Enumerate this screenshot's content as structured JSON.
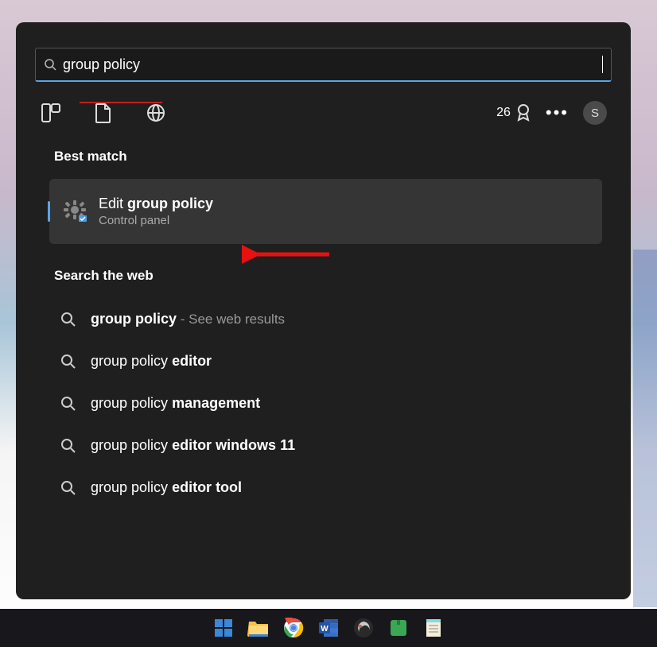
{
  "search": {
    "query": "group policy"
  },
  "rewards": {
    "count": "26"
  },
  "avatar": {
    "initial": "S"
  },
  "sections": {
    "best_match": "Best match",
    "search_web": "Search the web"
  },
  "best_match_result": {
    "title_prefix": "Edit ",
    "title_bold": "group policy",
    "subtitle": "Control panel"
  },
  "web_results": [
    {
      "prefix": "",
      "bold_first": "group policy",
      "middle": "",
      "bold_second": "",
      "suffix": " - See web results"
    },
    {
      "prefix": "group policy ",
      "bold_first": "",
      "middle": "",
      "bold_second": "editor",
      "suffix": ""
    },
    {
      "prefix": "group policy ",
      "bold_first": "",
      "middle": "",
      "bold_second": "management",
      "suffix": ""
    },
    {
      "prefix": "group policy ",
      "bold_first": "",
      "middle": "",
      "bold_second": "editor windows 11",
      "suffix": ""
    },
    {
      "prefix": "group policy ",
      "bold_first": "",
      "middle": "",
      "bold_second": "editor tool",
      "suffix": ""
    }
  ],
  "taskbar": {
    "items": [
      "start",
      "file-explorer",
      "chrome",
      "word",
      "obs",
      "app-green",
      "notepad"
    ]
  }
}
